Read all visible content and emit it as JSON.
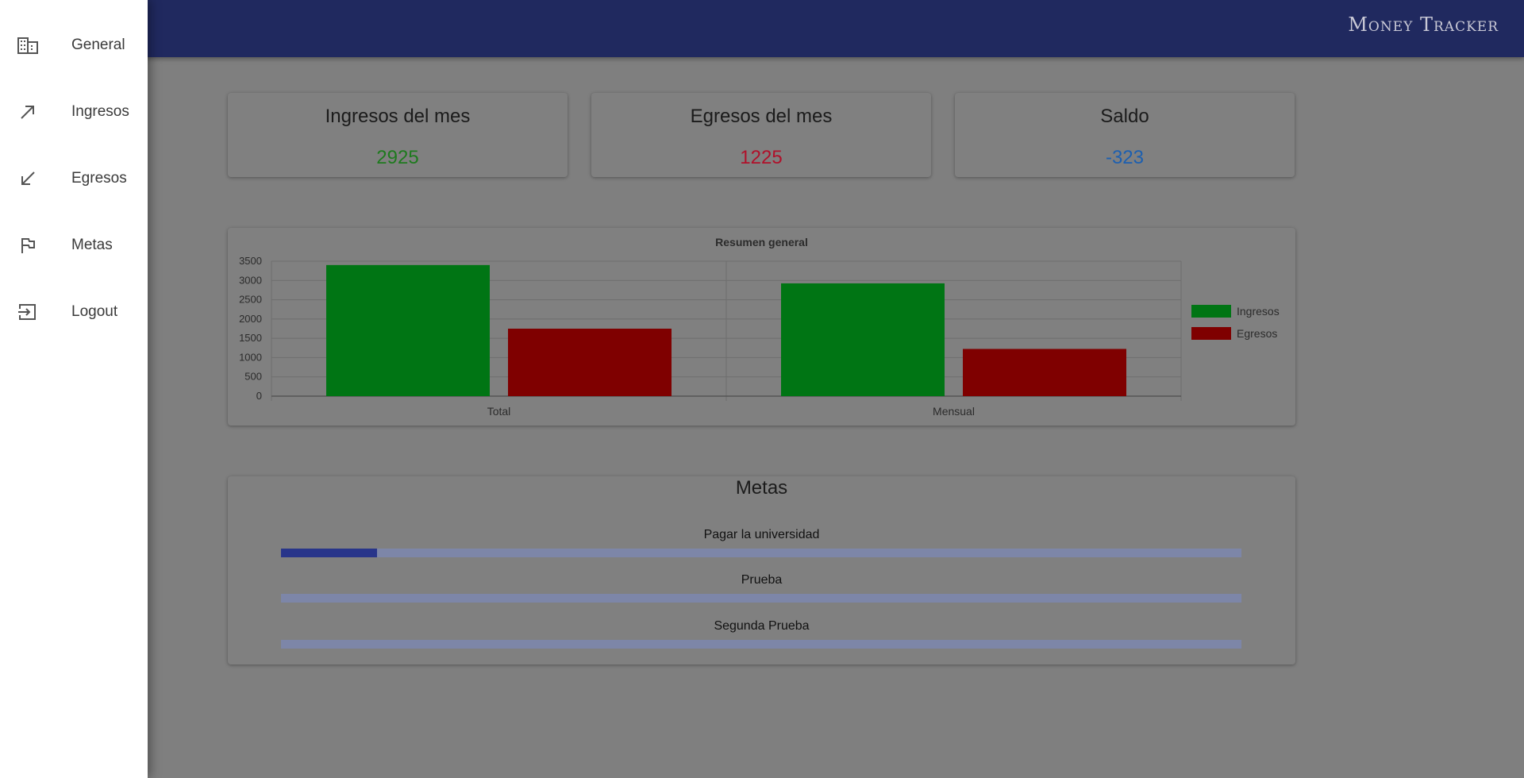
{
  "app": {
    "logo_text": "Money Tracker",
    "logo_icon": "tracker-logo-icon"
  },
  "sidebar": {
    "items": [
      {
        "label": "General",
        "icon": "building-icon"
      },
      {
        "label": "Ingresos",
        "icon": "arrow-up-right-icon"
      },
      {
        "label": "Egresos",
        "icon": "arrow-down-left-icon"
      },
      {
        "label": "Metas",
        "icon": "flag-icon"
      },
      {
        "label": "Logout",
        "icon": "logout-icon"
      }
    ]
  },
  "stats": [
    {
      "title": "Ingresos del mes",
      "value": "2925",
      "color": "#1e7a1e"
    },
    {
      "title": "Egresos del mes",
      "value": "1225",
      "color": "#b0102a"
    },
    {
      "title": "Saldo",
      "value": "-323",
      "color": "#1c5fb0"
    }
  ],
  "chart_data": {
    "type": "bar",
    "title": "Resumen general",
    "categories": [
      "Total",
      "Mensual"
    ],
    "series": [
      {
        "name": "Ingresos",
        "values": [
          3400,
          2925
        ],
        "color": "#007514"
      },
      {
        "name": "Egresos",
        "values": [
          1750,
          1225
        ],
        "color": "#7f0000"
      }
    ],
    "ylim": [
      0,
      3500
    ],
    "yticks": [
      0,
      500,
      1000,
      1500,
      2000,
      2500,
      3000,
      3500
    ],
    "grid": true,
    "legend": "right"
  },
  "metas": {
    "title": "Metas",
    "goals": [
      {
        "label": "Pagar la universidad",
        "progress": 0.1
      },
      {
        "label": "Prueba",
        "progress": 0
      },
      {
        "label": "Segunda Prueba",
        "progress": 0
      }
    ]
  }
}
